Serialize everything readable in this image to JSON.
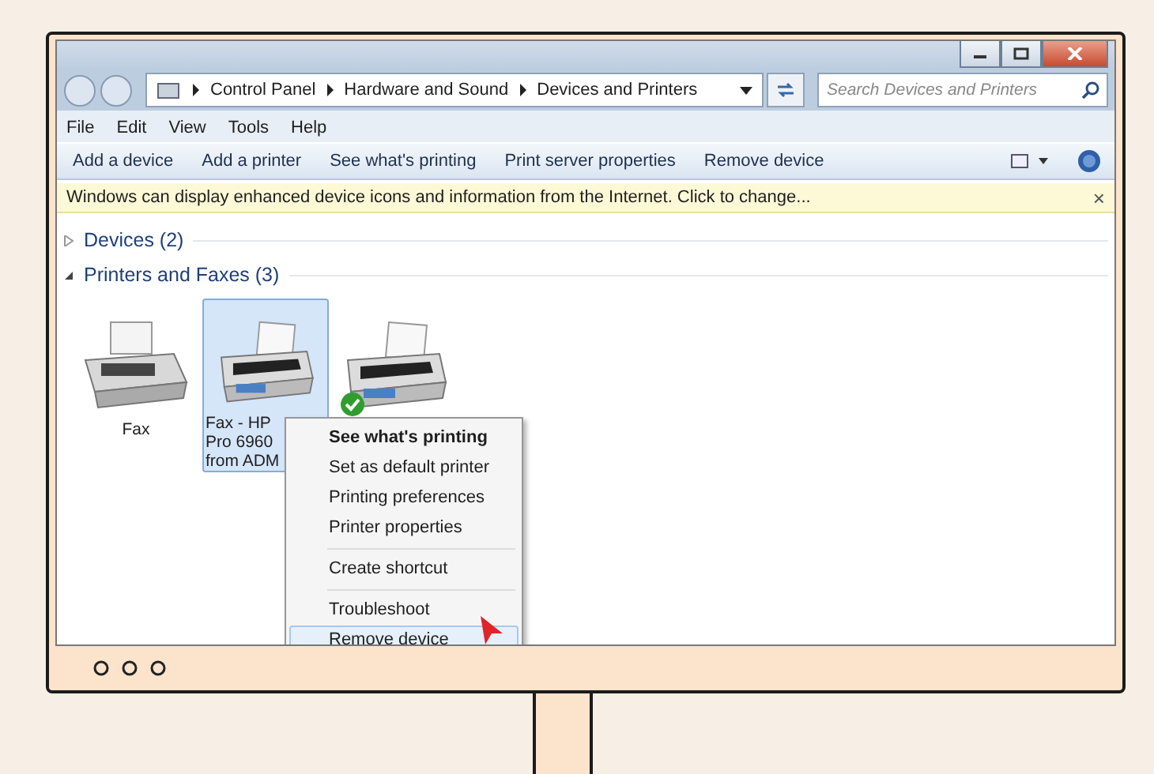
{
  "address": {
    "crumbs": [
      "Control Panel",
      "Hardware and Sound",
      "Devices and Printers"
    ]
  },
  "search": {
    "placeholder": "Search Devices and Printers"
  },
  "menu_bar": [
    "File",
    "Edit",
    "View",
    "Tools",
    "Help"
  ],
  "toolbar": [
    "Add a device",
    "Add a printer",
    "See what's printing",
    "Print server properties",
    "Remove device"
  ],
  "info_bar": {
    "text": "Windows can display enhanced device icons and information from the Internet. Click to change...",
    "close": "×"
  },
  "sections": [
    {
      "title": "Devices (2)",
      "expanded": false
    },
    {
      "title": "Printers and Faxes (3)",
      "expanded": true
    }
  ],
  "devices": [
    {
      "kind": "fax",
      "lines": [
        "Fax"
      ],
      "selected": false,
      "default": false
    },
    {
      "kind": "printer",
      "lines": [
        "Fax - HP",
        "Pro 6960",
        "from ADM"
      ],
      "selected": true,
      "default": false
    },
    {
      "kind": "printer",
      "selected": false,
      "default": true
    }
  ],
  "context_menu": {
    "groups": [
      [
        {
          "label": "See what's printing",
          "kind": "default",
          "selected": false
        },
        {
          "label": "Set as default printer",
          "kind": "item",
          "selected": false
        },
        {
          "label": "Printing preferences",
          "kind": "item",
          "selected": false
        },
        {
          "label": "Printer properties",
          "kind": "item",
          "selected": false
        }
      ],
      [
        {
          "label": "Create shortcut",
          "kind": "item",
          "selected": false
        }
      ],
      [
        {
          "label": "Troubleshoot",
          "kind": "item",
          "selected": false
        },
        {
          "label": "Remove device",
          "kind": "item",
          "selected": true
        }
      ]
    ]
  }
}
